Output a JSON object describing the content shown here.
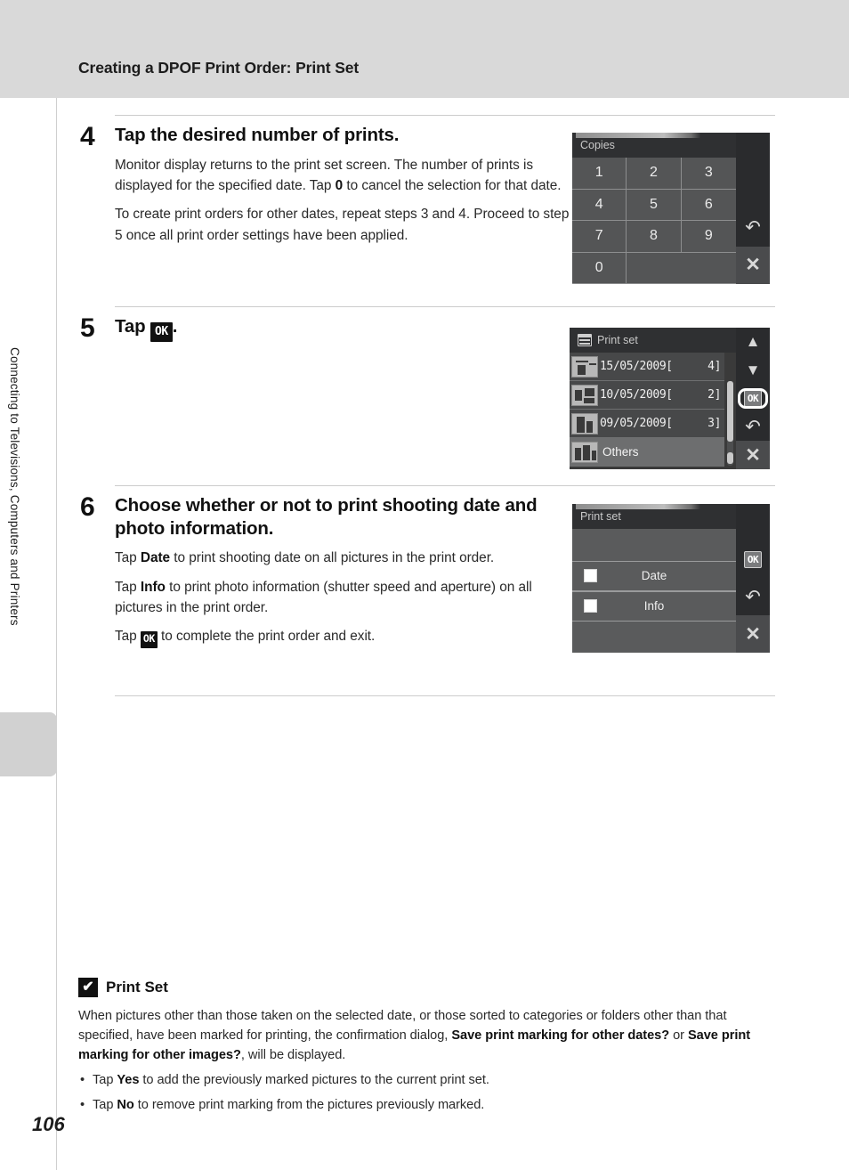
{
  "header": {
    "title": "Creating a DPOF Print Order: Print Set"
  },
  "sidebar": {
    "chapter_label": "Connecting to Televisions, Computers and Printers",
    "page_number": "106"
  },
  "steps": [
    {
      "number": "4",
      "heading": "Tap the desired number of prints.",
      "paragraphs": [
        "Monitor display returns to the print set screen. The number of prints is displayed for the specified date. Tap ",
        "to cancel the selection for that date.",
        "To create print orders for other dates, repeat steps 3 and 4. Proceed to step 5 once all print order settings have been applied."
      ],
      "bold_inline": "0"
    },
    {
      "number": "5",
      "heading_prefix": "Tap",
      "heading_suffix": ".",
      "heading_icon": "ok-icon"
    },
    {
      "number": "6",
      "heading": "Choose whether or not to print shooting date and photo information.",
      "p1_a": "Tap ",
      "p1_b": "Date",
      "p1_c": " to print shooting date on all pictures in the print order.",
      "p2_a": "Tap ",
      "p2_b": "Info",
      "p2_c": " to print photo information (shutter speed and aperture) on all pictures in the print order.",
      "p3_a": "Tap",
      "p3_c": "to complete the print order and exit."
    }
  ],
  "screens": {
    "copies": {
      "title": "Copies",
      "keys": [
        "1",
        "2",
        "3",
        "4",
        "5",
        "6",
        "7",
        "8",
        "9",
        "0",
        "",
        ""
      ],
      "rail": [
        "back-icon",
        "close-icon"
      ]
    },
    "print_set_list": {
      "title": "Print set",
      "title_icon": "date-icon",
      "rows": [
        {
          "date": "15/05/2009[",
          "count": "4]",
          "thumb": "photo-thumb-1"
        },
        {
          "date": "10/05/2009[",
          "count": "2]",
          "thumb": "photo-thumb-2"
        },
        {
          "date": "09/05/2009[",
          "count": "3]",
          "thumb": "photo-thumb-3"
        },
        {
          "label": "Others",
          "thumb": "photo-thumb-4"
        }
      ],
      "rail": [
        "chevron-up-icon",
        "chevron-down-icon",
        "OK",
        "back-icon",
        "close-icon"
      ],
      "ok_label": "OK",
      "ok_highlighted": true
    },
    "print_set_options": {
      "title": "Print set",
      "options": [
        {
          "label": "Date",
          "checked": false
        },
        {
          "label": "Info",
          "checked": false
        }
      ],
      "rail": [
        "OK",
        "back-icon",
        "close-icon"
      ],
      "ok_label": "OK"
    }
  },
  "note": {
    "icon": "caution-check-icon",
    "icon_glyph": "✔",
    "title": "Print Set",
    "body_a": "When pictures other than those taken on the selected date, or those sorted to categories or folders other than that specified, have been marked for printing, the confirmation dialog, ",
    "body_b": "Save print marking for other dates?",
    "body_c": " or ",
    "body_d": "Save print marking for other images?",
    "body_e": ", will be displayed.",
    "bullets": [
      {
        "a": "Tap ",
        "b": "Yes",
        "c": " to add the previously marked pictures to the current print set."
      },
      {
        "a": "Tap ",
        "b": "No",
        "c": " to remove print marking from the pictures previously marked."
      }
    ]
  },
  "colors": {
    "header_band": "#d9d9d9",
    "lcd_bezel": "#111214",
    "lcd_screen": "#3a3a3a",
    "rail": "#2a2b2d"
  }
}
